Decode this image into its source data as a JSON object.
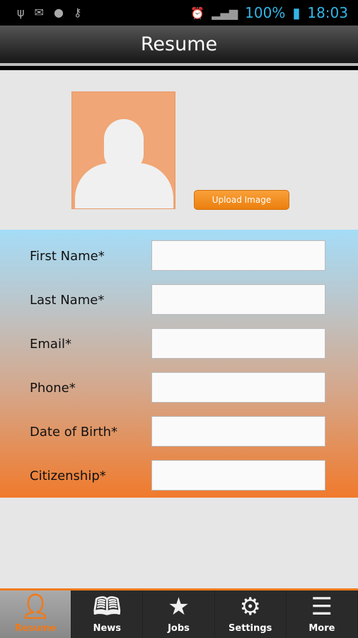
{
  "status_bar": {
    "battery": "100%",
    "time": "18:03"
  },
  "app_bar": {
    "title": "Resume"
  },
  "profile": {
    "upload_label": "Upload Image"
  },
  "form": {
    "fields": [
      {
        "label": "First Name*",
        "value": ""
      },
      {
        "label": "Last Name*",
        "value": ""
      },
      {
        "label": "Email*",
        "value": ""
      },
      {
        "label": "Phone*",
        "value": ""
      },
      {
        "label": "Date of Birth*",
        "value": ""
      },
      {
        "label": "Citizenship*",
        "value": ""
      }
    ]
  },
  "tabs": [
    {
      "label": "Resume",
      "icon": "person-icon"
    },
    {
      "label": "News",
      "icon": "book-icon"
    },
    {
      "label": "Jobs",
      "icon": "star-icon"
    },
    {
      "label": "Settings",
      "icon": "gears-icon"
    },
    {
      "label": "More",
      "icon": "menu-icon"
    }
  ],
  "colors": {
    "accent": "#f07a1a",
    "status": "#33b5e5"
  }
}
